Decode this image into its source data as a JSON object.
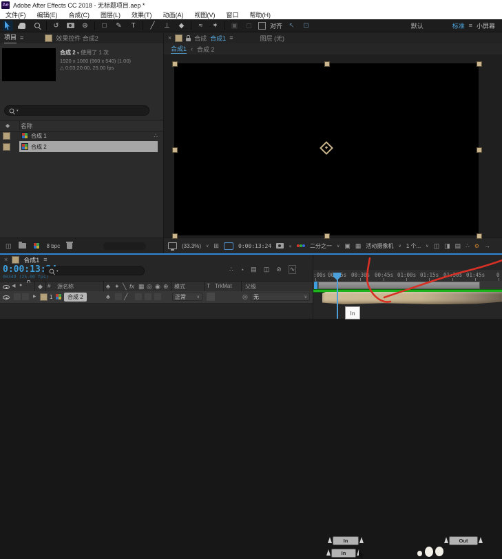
{
  "window": {
    "logo_text": "Ae",
    "title": "Adobe After Effects CC 2018 - 无标题项目.aep *"
  },
  "menu_bar": {
    "items": [
      "文件(F)",
      "编辑(E)",
      "合成(C)",
      "图层(L)",
      "效果(T)",
      "动画(A)",
      "视图(V)",
      "窗口",
      "帮助(H)"
    ]
  },
  "toolbar": {
    "snap_label": "对齐",
    "workspaces": {
      "default": "默认",
      "standard": "标准",
      "small_screen": "小屏幕"
    }
  },
  "icons": {
    "menu": "≡",
    "close": "×",
    "chevron": "∨",
    "dropdown": "▾",
    "expand": "▶",
    "rotate": "↺",
    "pan_behind": "⊕",
    "rectangle": "□",
    "pen": "✎",
    "type": "T",
    "brush": "╱",
    "stamp": "⊥",
    "eraser": "◆",
    "roto_brush": "≈",
    "puppet": "✶",
    "workspace_a": "▣",
    "workspace_b": "◻",
    "snap_a": "↖",
    "snap_b": "⊡",
    "grid": "⊞",
    "transparency_grid": "▦",
    "roi": "▣",
    "audio": "◀",
    "solo": "●",
    "label_tag": "◆",
    "parent_pickwhip": "◎",
    "used_tree": "∴",
    "duration": "△",
    "hash": "#",
    "snapshot_dot": "●",
    "interpret": "◫",
    "tl_flowchart": "∴",
    "tl_shy": "◔",
    "tl_frame_blend": "▤",
    "tl_layers": "◫",
    "tl_motion_blur": "⊘",
    "tl_graph": "∿",
    "sw_shy": "♣",
    "sw_collapse": "✦",
    "sw_quality": "╲",
    "sw_fx": "fx",
    "sw_frame_blend": "▦",
    "sw_motion_blur": "◎",
    "sw_adjustment": "◉",
    "sw_3d": "⊕",
    "quality_slash": "╱",
    "club": "♣",
    "view_layout": "◫",
    "share_view": "◨",
    "exposure": "▤",
    "flowchart2": "∴",
    "gear": "⚙",
    "arrow_right": "→"
  },
  "project_panel": {
    "tab_project": "项目",
    "tab_effect_controls": "效果控件 合成2",
    "preview": {
      "name": "合成 2",
      "usage": "使用了 1 次",
      "line2": "1920 x 1080 (960 x 540) (1.00)",
      "line3": "0:03:20:00, 25.00 fps"
    },
    "columns": {
      "name": "名称"
    },
    "items": [
      {
        "name": "合成 1"
      },
      {
        "name": "合成 2"
      }
    ],
    "footer": {
      "bpc": "8 bpc"
    }
  },
  "comp_panel": {
    "comp_label": "合成",
    "comp_name": "合成1",
    "tab_layer": "图层 (无)",
    "breadcrumb": {
      "comp1": "合成1",
      "sep": "‹",
      "comp2": "合成 2"
    },
    "footer": {
      "zoom": "(33.3%)",
      "timecode": "0:00:13:24",
      "resolution": "二分之一",
      "camera": "活动摄像机",
      "views": "1 个..."
    }
  },
  "timeline_panel": {
    "tab": {
      "name": "合成1"
    },
    "timecode": "0:00:13:24",
    "frame_info": "00349 (25.00 fps)",
    "columns": {
      "source_name": "源名称",
      "mode": "模式",
      "t": "T",
      "trkmat": "TrkMat",
      "parent": "父级"
    },
    "layer": {
      "index": "1",
      "name": "合成 2",
      "mode": "正常",
      "parent": "无"
    },
    "ruler": {
      "labels": [
        ":00s",
        "00:15s",
        "00:30s",
        "00:45s",
        "01:00s",
        "01:15s",
        "01:30s",
        "01:45s",
        "0"
      ]
    },
    "trim": {
      "in": "In",
      "out": "Out",
      "tooltip": "In"
    }
  },
  "colors": {
    "accent_blue": "#4ba0d8",
    "label_tan": "#b5a27b",
    "green_line": "#1db41d",
    "annotation_red": "#d93025"
  }
}
